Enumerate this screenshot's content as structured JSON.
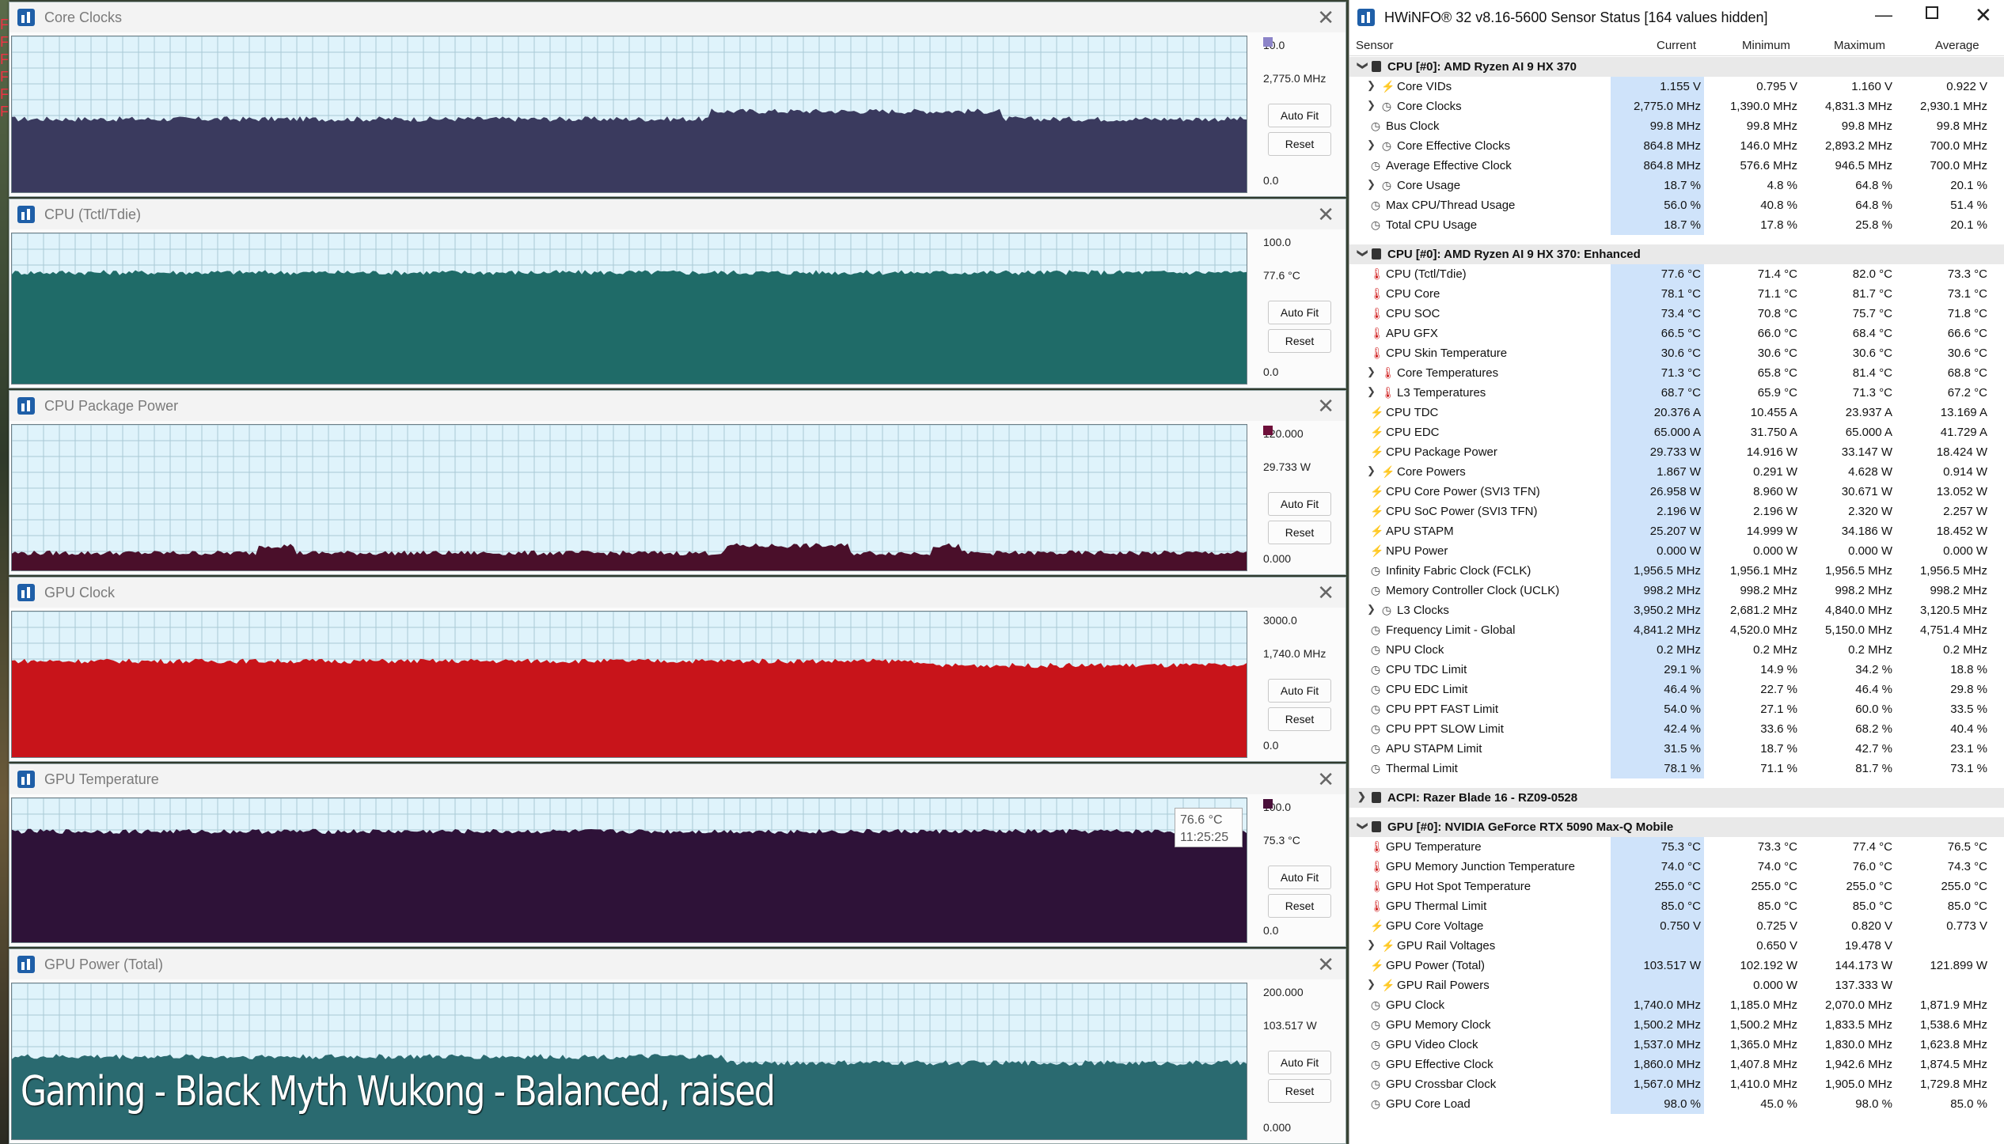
{
  "graphs": [
    {
      "title": "Core Clocks",
      "top_value": "10.0",
      "current": "2,775.0 MHz",
      "bottom_value": "0.0",
      "autofit": "Auto Fit",
      "reset": "Reset",
      "color": "#3a3a5e",
      "swatch": "#8c84c8",
      "level": 0.47,
      "fill_opacity": 1
    },
    {
      "title": "CPU (Tctl/Tdie)",
      "top_value": "100.0",
      "current": "77.6 °C",
      "bottom_value": "0.0",
      "autofit": "Auto Fit",
      "reset": "Reset",
      "color": "#1f6b68",
      "swatch": "",
      "level": 0.74,
      "fill_opacity": 1
    },
    {
      "title": "CPU Package Power",
      "top_value": "120.000",
      "current": "29.733 W",
      "bottom_value": "0.000",
      "autofit": "Auto Fit",
      "reset": "Reset",
      "color": "#4a0f2a",
      "swatch": "#6e0f3a",
      "level": 0.12,
      "fill_opacity": 1
    },
    {
      "title": "GPU Clock",
      "top_value": "3000.0",
      "current": "1,740.0 MHz",
      "bottom_value": "0.0",
      "autofit": "Auto Fit",
      "reset": "Reset",
      "color": "#c8141a",
      "swatch": "",
      "level": 0.66,
      "fill_opacity": 1
    },
    {
      "title": "GPU Temperature",
      "top_value": "100.0",
      "current": "75.3 °C",
      "bottom_value": "0.0",
      "autofit": "Auto Fit",
      "reset": "Reset",
      "color": "#2e1238",
      "swatch": "#4a0f3a",
      "level": 0.77,
      "fill_opacity": 1
    },
    {
      "title": "GPU Power (Total)",
      "top_value": "200.000",
      "current": "103.517 W",
      "bottom_value": "0.000",
      "autofit": "Auto Fit",
      "reset": "Reset",
      "color": "#2a6a70",
      "swatch": "",
      "level": 0.53,
      "fill_opacity": 1
    }
  ],
  "tooltip": {
    "value": "76.6 °C",
    "time": "11:25:25"
  },
  "caption": "Gaming - Black Myth Wukong - Balanced, raised",
  "desktop_letters": [
    "F",
    "F",
    "F",
    "F",
    "F",
    "F"
  ],
  "sensor_window": {
    "title": "HWiNFO® 32 v8.16-5600 Sensor Status [164 values hidden]",
    "columns": {
      "sensor": "Sensor",
      "current": "Current",
      "minimum": "Minimum",
      "maximum": "Maximum",
      "average": "Average"
    },
    "rows": [
      {
        "type": "group",
        "name": "CPU [#0]: AMD Ryzen AI 9 HX 370"
      },
      {
        "type": "item",
        "icon": "volt",
        "sub": true,
        "name": "Core VIDs",
        "cur": "1.155 V",
        "min": "0.795 V",
        "max": "1.160 V",
        "avg": "0.922 V"
      },
      {
        "type": "item",
        "icon": "clk",
        "sub": true,
        "name": "Core Clocks",
        "cur": "2,775.0 MHz",
        "min": "1,390.0 MHz",
        "max": "4,831.3 MHz",
        "avg": "2,930.1 MHz"
      },
      {
        "type": "item",
        "icon": "clk",
        "sub": false,
        "name": "Bus Clock",
        "cur": "99.8 MHz",
        "min": "99.8 MHz",
        "max": "99.8 MHz",
        "avg": "99.8 MHz"
      },
      {
        "type": "item",
        "icon": "clk",
        "sub": true,
        "name": "Core Effective Clocks",
        "cur": "864.8 MHz",
        "min": "146.0 MHz",
        "max": "2,893.2 MHz",
        "avg": "700.0 MHz"
      },
      {
        "type": "item",
        "icon": "clk",
        "sub": false,
        "name": "Average Effective Clock",
        "cur": "864.8 MHz",
        "min": "576.6 MHz",
        "max": "946.5 MHz",
        "avg": "700.0 MHz"
      },
      {
        "type": "item",
        "icon": "clk",
        "sub": true,
        "name": "Core Usage",
        "cur": "18.7 %",
        "min": "4.8 %",
        "max": "64.8 %",
        "avg": "20.1 %"
      },
      {
        "type": "item",
        "icon": "clk",
        "sub": false,
        "name": "Max CPU/Thread Usage",
        "cur": "56.0 %",
        "min": "40.8 %",
        "max": "64.8 %",
        "avg": "51.4 %"
      },
      {
        "type": "item",
        "icon": "clk",
        "sub": false,
        "name": "Total CPU Usage",
        "cur": "18.7 %",
        "min": "17.8 %",
        "max": "25.8 %",
        "avg": "20.1 %"
      },
      {
        "type": "blank"
      },
      {
        "type": "group",
        "name": "CPU [#0]: AMD Ryzen AI 9 HX 370: Enhanced"
      },
      {
        "type": "item",
        "icon": "therm",
        "sub": false,
        "name": "CPU (Tctl/Tdie)",
        "cur": "77.6 °C",
        "min": "71.4 °C",
        "max": "82.0 °C",
        "avg": "73.3 °C"
      },
      {
        "type": "item",
        "icon": "therm",
        "sub": false,
        "name": "CPU Core",
        "cur": "78.1 °C",
        "min": "71.1 °C",
        "max": "81.7 °C",
        "avg": "73.1 °C"
      },
      {
        "type": "item",
        "icon": "therm",
        "sub": false,
        "name": "CPU SOC",
        "cur": "73.4 °C",
        "min": "70.8 °C",
        "max": "75.7 °C",
        "avg": "71.8 °C"
      },
      {
        "type": "item",
        "icon": "therm",
        "sub": false,
        "name": "APU GFX",
        "cur": "66.5 °C",
        "min": "66.0 °C",
        "max": "68.4 °C",
        "avg": "66.6 °C"
      },
      {
        "type": "item",
        "icon": "therm",
        "sub": false,
        "name": "CPU Skin Temperature",
        "cur": "30.6 °C",
        "min": "30.6 °C",
        "max": "30.6 °C",
        "avg": "30.6 °C"
      },
      {
        "type": "item",
        "icon": "therm",
        "sub": true,
        "name": "Core Temperatures",
        "cur": "71.3 °C",
        "min": "65.8 °C",
        "max": "81.4 °C",
        "avg": "68.8 °C"
      },
      {
        "type": "item",
        "icon": "therm",
        "sub": true,
        "name": "L3 Temperatures",
        "cur": "68.7 °C",
        "min": "65.9 °C",
        "max": "71.3 °C",
        "avg": "67.2 °C"
      },
      {
        "type": "item",
        "icon": "volt",
        "sub": false,
        "name": "CPU TDC",
        "cur": "20.376 A",
        "min": "10.455 A",
        "max": "23.937 A",
        "avg": "13.169 A"
      },
      {
        "type": "item",
        "icon": "volt",
        "sub": false,
        "name": "CPU EDC",
        "cur": "65.000 A",
        "min": "31.750 A",
        "max": "65.000 A",
        "avg": "41.729 A"
      },
      {
        "type": "item",
        "icon": "volt",
        "sub": false,
        "name": "CPU Package Power",
        "cur": "29.733 W",
        "min": "14.916 W",
        "max": "33.147 W",
        "avg": "18.424 W"
      },
      {
        "type": "item",
        "icon": "volt",
        "sub": true,
        "name": "Core Powers",
        "cur": "1.867 W",
        "min": "0.291 W",
        "max": "4.628 W",
        "avg": "0.914 W"
      },
      {
        "type": "item",
        "icon": "volt",
        "sub": false,
        "name": "CPU Core Power (SVI3 TFN)",
        "cur": "26.958 W",
        "min": "8.960 W",
        "max": "30.671 W",
        "avg": "13.052 W"
      },
      {
        "type": "item",
        "icon": "volt",
        "sub": false,
        "name": "CPU SoC Power (SVI3 TFN)",
        "cur": "2.196 W",
        "min": "2.196 W",
        "max": "2.320 W",
        "avg": "2.257 W"
      },
      {
        "type": "item",
        "icon": "volt",
        "sub": false,
        "name": "APU STAPM",
        "cur": "25.207 W",
        "min": "14.999 W",
        "max": "34.186 W",
        "avg": "18.452 W"
      },
      {
        "type": "item",
        "icon": "volt",
        "sub": false,
        "name": "NPU Power",
        "cur": "0.000 W",
        "min": "0.000 W",
        "max": "0.000 W",
        "avg": "0.000 W"
      },
      {
        "type": "item",
        "icon": "clk",
        "sub": false,
        "name": "Infinity Fabric Clock (FCLK)",
        "cur": "1,956.5 MHz",
        "min": "1,956.1 MHz",
        "max": "1,956.5 MHz",
        "avg": "1,956.5 MHz"
      },
      {
        "type": "item",
        "icon": "clk",
        "sub": false,
        "name": "Memory Controller Clock (UCLK)",
        "cur": "998.2 MHz",
        "min": "998.2 MHz",
        "max": "998.2 MHz",
        "avg": "998.2 MHz"
      },
      {
        "type": "item",
        "icon": "clk",
        "sub": true,
        "name": "L3 Clocks",
        "cur": "3,950.2 MHz",
        "min": "2,681.2 MHz",
        "max": "4,840.0 MHz",
        "avg": "3,120.5 MHz"
      },
      {
        "type": "item",
        "icon": "clk",
        "sub": false,
        "name": "Frequency Limit - Global",
        "cur": "4,841.2 MHz",
        "min": "4,520.0 MHz",
        "max": "5,150.0 MHz",
        "avg": "4,751.4 MHz"
      },
      {
        "type": "item",
        "icon": "clk",
        "sub": false,
        "name": "NPU Clock",
        "cur": "0.2 MHz",
        "min": "0.2 MHz",
        "max": "0.2 MHz",
        "avg": "0.2 MHz"
      },
      {
        "type": "item",
        "icon": "clk",
        "sub": false,
        "name": "CPU TDC Limit",
        "cur": "29.1 %",
        "min": "14.9 %",
        "max": "34.2 %",
        "avg": "18.8 %"
      },
      {
        "type": "item",
        "icon": "clk",
        "sub": false,
        "name": "CPU EDC Limit",
        "cur": "46.4 %",
        "min": "22.7 %",
        "max": "46.4 %",
        "avg": "29.8 %"
      },
      {
        "type": "item",
        "icon": "clk",
        "sub": false,
        "name": "CPU PPT FAST Limit",
        "cur": "54.0 %",
        "min": "27.1 %",
        "max": "60.0 %",
        "avg": "33.5 %"
      },
      {
        "type": "item",
        "icon": "clk",
        "sub": false,
        "name": "CPU PPT SLOW Limit",
        "cur": "42.4 %",
        "min": "33.6 %",
        "max": "68.2 %",
        "avg": "40.4 %"
      },
      {
        "type": "item",
        "icon": "clk",
        "sub": false,
        "name": "APU STAPM Limit",
        "cur": "31.5 %",
        "min": "18.7 %",
        "max": "42.7 %",
        "avg": "23.1 %"
      },
      {
        "type": "item",
        "icon": "clk",
        "sub": false,
        "name": "Thermal Limit",
        "cur": "78.1 %",
        "min": "71.1 %",
        "max": "81.7 %",
        "avg": "73.1 %"
      },
      {
        "type": "blank"
      },
      {
        "type": "group",
        "collapsed": true,
        "name": "ACPI: Razer Blade 16 - RZ09-0528"
      },
      {
        "type": "blank"
      },
      {
        "type": "group",
        "name": "GPU [#0]: NVIDIA  GeForce RTX 5090 Max-Q Mobile"
      },
      {
        "type": "item",
        "icon": "therm",
        "sub": false,
        "name": "GPU Temperature",
        "cur": "75.3 °C",
        "min": "73.3 °C",
        "max": "77.4 °C",
        "avg": "76.5 °C"
      },
      {
        "type": "item",
        "icon": "therm",
        "sub": false,
        "name": "GPU Memory Junction Temperature",
        "cur": "74.0 °C",
        "min": "74.0 °C",
        "max": "76.0 °C",
        "avg": "74.3 °C"
      },
      {
        "type": "item",
        "icon": "therm",
        "sub": false,
        "name": "GPU Hot Spot Temperature",
        "cur": "255.0 °C",
        "min": "255.0 °C",
        "max": "255.0 °C",
        "avg": "255.0 °C"
      },
      {
        "type": "item",
        "icon": "therm",
        "sub": false,
        "name": "GPU Thermal Limit",
        "cur": "85.0 °C",
        "min": "85.0 °C",
        "max": "85.0 °C",
        "avg": "85.0 °C"
      },
      {
        "type": "item",
        "icon": "volt",
        "sub": false,
        "name": "GPU Core Voltage",
        "cur": "0.750 V",
        "min": "0.725 V",
        "max": "0.820 V",
        "avg": "0.773 V"
      },
      {
        "type": "item",
        "icon": "volt",
        "sub": true,
        "name": "GPU Rail Voltages",
        "cur": "",
        "min": "0.650 V",
        "max": "19.478 V",
        "avg": ""
      },
      {
        "type": "item",
        "icon": "volt",
        "sub": false,
        "name": "GPU Power (Total)",
        "cur": "103.517 W",
        "min": "102.192 W",
        "max": "144.173 W",
        "avg": "121.899 W"
      },
      {
        "type": "item",
        "icon": "volt",
        "sub": true,
        "name": "GPU Rail Powers",
        "cur": "",
        "min": "0.000 W",
        "max": "137.333 W",
        "avg": ""
      },
      {
        "type": "item",
        "icon": "clk",
        "sub": false,
        "name": "GPU Clock",
        "cur": "1,740.0 MHz",
        "min": "1,185.0 MHz",
        "max": "2,070.0 MHz",
        "avg": "1,871.9 MHz"
      },
      {
        "type": "item",
        "icon": "clk",
        "sub": false,
        "name": "GPU Memory Clock",
        "cur": "1,500.2 MHz",
        "min": "1,500.2 MHz",
        "max": "1,833.5 MHz",
        "avg": "1,538.6 MHz"
      },
      {
        "type": "item",
        "icon": "clk",
        "sub": false,
        "name": "GPU Video Clock",
        "cur": "1,537.0 MHz",
        "min": "1,365.0 MHz",
        "max": "1,830.0 MHz",
        "avg": "1,623.8 MHz"
      },
      {
        "type": "item",
        "icon": "clk",
        "sub": false,
        "name": "GPU Effective Clock",
        "cur": "1,860.0 MHz",
        "min": "1,407.8 MHz",
        "max": "1,942.6 MHz",
        "avg": "1,874.5 MHz"
      },
      {
        "type": "item",
        "icon": "clk",
        "sub": false,
        "name": "GPU Crossbar Clock",
        "cur": "1,567.0 MHz",
        "min": "1,410.0 MHz",
        "max": "1,905.0 MHz",
        "avg": "1,729.8 MHz"
      },
      {
        "type": "item",
        "icon": "clk",
        "sub": false,
        "name": "GPU Core Load",
        "cur": "98.0 %",
        "min": "45.0 %",
        "max": "98.0 %",
        "avg": "85.0 %"
      }
    ]
  }
}
